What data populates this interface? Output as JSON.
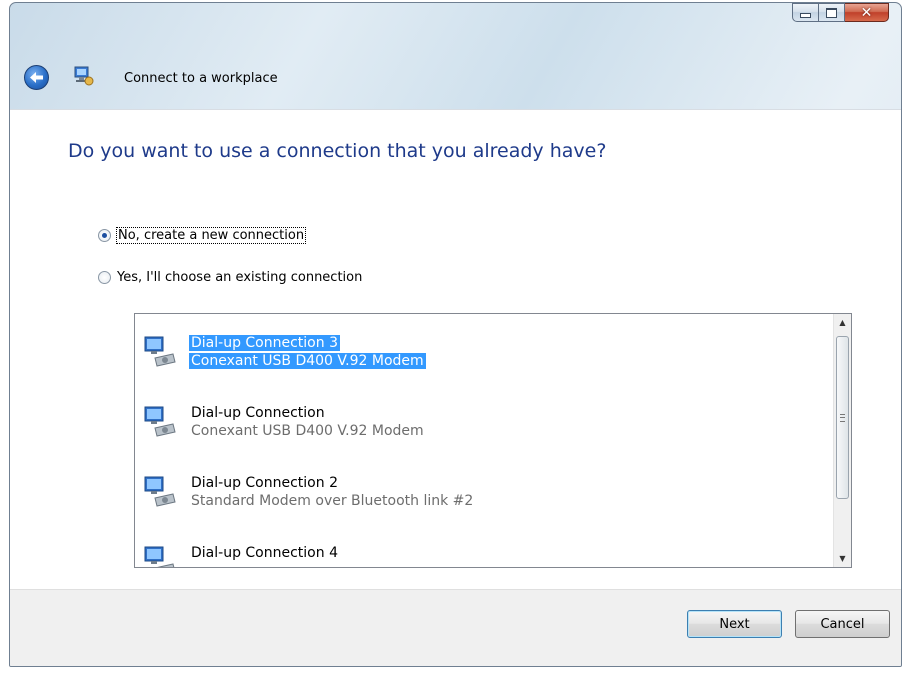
{
  "window": {
    "title": "Connect to a workplace",
    "caption_buttons": {
      "minimize": "minimize-icon",
      "maximize": "maximize-icon",
      "close": "close-icon"
    }
  },
  "main": {
    "heading": "Do you want to use a connection that you already have?",
    "options": [
      {
        "label": "No, create a new connection",
        "selected": true
      },
      {
        "label": "Yes, I'll choose an existing connection",
        "selected": false
      }
    ],
    "connections": [
      {
        "name": "Dial-up Connection 3",
        "device": "Conexant USB D400 V.92 Modem",
        "selected": true
      },
      {
        "name": "Dial-up Connection",
        "device": "Conexant USB D400 V.92 Modem",
        "selected": false
      },
      {
        "name": "Dial-up Connection 2",
        "device": "Standard Modem over Bluetooth link #2",
        "selected": false
      },
      {
        "name": "Dial-up Connection 4",
        "device": "",
        "selected": false
      }
    ]
  },
  "footer": {
    "next_label": "Next",
    "cancel_label": "Cancel"
  },
  "colors": {
    "heading": "#1e3a8a",
    "selection": "#3399ff"
  }
}
